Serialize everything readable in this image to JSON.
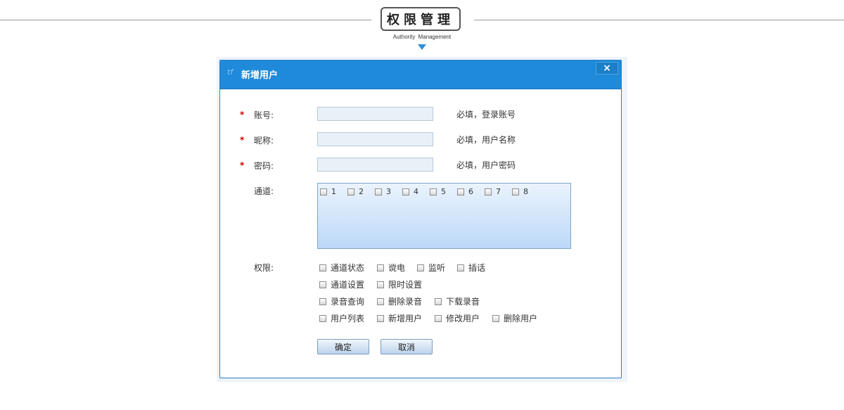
{
  "header": {
    "title": "权限管理",
    "subtitle": "Authority  Management"
  },
  "dialog": {
    "icon": "tf",
    "title": "新增用户",
    "close_label": "×",
    "fields": {
      "account": {
        "label": "账号:",
        "required_mark": "*",
        "value": "",
        "hint": "必填，登录账号"
      },
      "nickname": {
        "label": "昵称:",
        "required_mark": "*",
        "value": "",
        "hint": "必填，用户名称"
      },
      "password": {
        "label": "密码:",
        "required_mark": "*",
        "value": "",
        "hint": "必填，用户密码"
      }
    },
    "channels": {
      "label": "通道:",
      "items": [
        "1",
        "2",
        "3",
        "4",
        "5",
        "6",
        "7",
        "8"
      ]
    },
    "permissions": {
      "label": "权限:",
      "rows": [
        [
          "通道状态",
          "谠电",
          "监听",
          "插话"
        ],
        [
          "通道设置",
          "限时设置"
        ],
        [
          "录音查询",
          "删除录音",
          "下载录音"
        ],
        [
          "用户列表",
          "新增用户",
          "修改用户",
          "删除用户"
        ]
      ]
    },
    "buttons": {
      "confirm": "确定",
      "cancel": "取消"
    }
  },
  "colors": {
    "titlebar": "#1f8ad9",
    "accent_arrow": "#2e8fd8",
    "required": "#cc0000"
  }
}
